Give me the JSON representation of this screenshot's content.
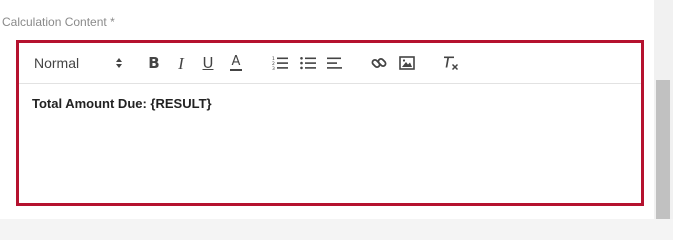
{
  "field": {
    "label": "Calculation Content *"
  },
  "toolbar": {
    "format_value": "Normal",
    "bold": "B",
    "italic": "I",
    "underline": "U",
    "font_color": "A",
    "buttons": [
      {
        "icon": "bold-icon"
      },
      {
        "icon": "italic-icon"
      },
      {
        "icon": "underline-icon"
      },
      {
        "icon": "font-color-icon"
      },
      {
        "icon": "ordered-list-icon"
      },
      {
        "icon": "bullet-list-icon"
      },
      {
        "icon": "align-left-icon"
      },
      {
        "icon": "link-icon"
      },
      {
        "icon": "image-icon"
      },
      {
        "icon": "clear-format-icon"
      }
    ]
  },
  "editor": {
    "content": "Total Amount Due: {RESULT}"
  },
  "colors": {
    "focus_border": "#b5122f",
    "label": "#8a8a8a",
    "icon": "#444444"
  }
}
